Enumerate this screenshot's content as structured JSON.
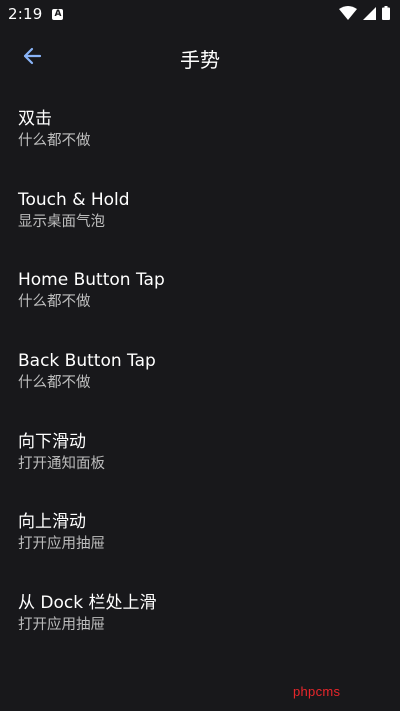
{
  "status_bar": {
    "time": "2:19",
    "app_icon_letter": "A"
  },
  "app_bar": {
    "title": "手势"
  },
  "settings": [
    {
      "title": "双击",
      "summary": "什么都不做"
    },
    {
      "title": "Touch & Hold",
      "summary": "显示桌面气泡"
    },
    {
      "title": "Home Button Tap",
      "summary": "什么都不做"
    },
    {
      "title": "Back Button Tap",
      "summary": "什么都不做"
    },
    {
      "title": "向下滑动",
      "summary": "打开通知面板"
    },
    {
      "title": "向上滑动",
      "summary": "打开应用抽屉"
    },
    {
      "title": "从 Dock 栏处上滑",
      "summary": "打开应用抽屉"
    }
  ],
  "watermark": "phpcms",
  "colors": {
    "background": "#18181b",
    "accent": "#8ab4f8",
    "summary_text": "#bdbdbd",
    "watermark": "#e8262b"
  }
}
